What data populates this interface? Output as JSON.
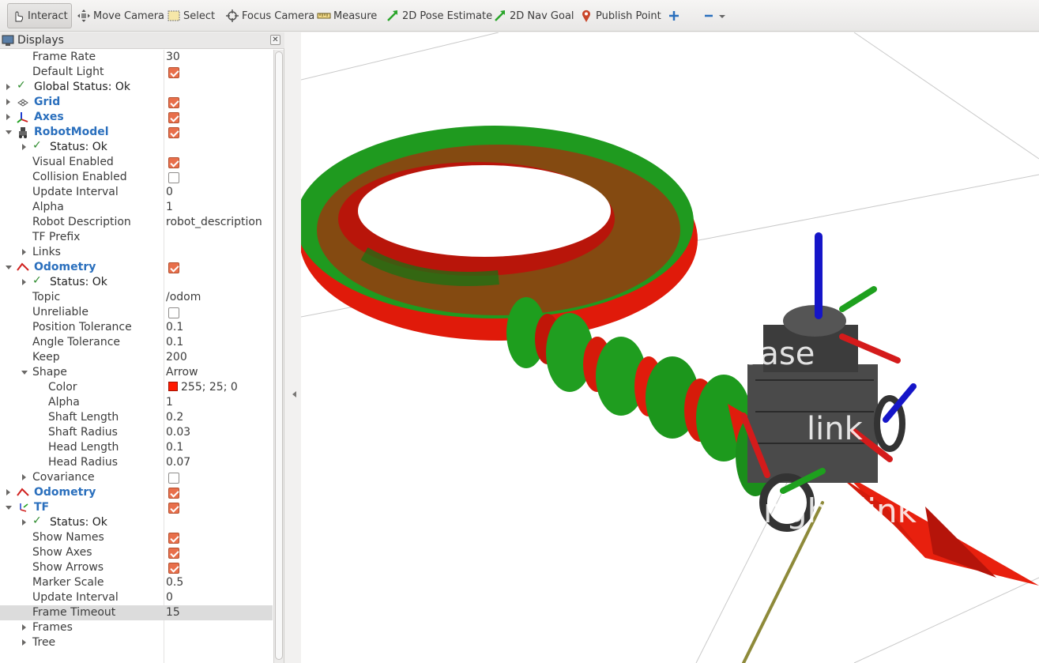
{
  "toolbar": {
    "tools": [
      {
        "label": "Interact",
        "icon": "hand-pointer-icon",
        "active": true
      },
      {
        "label": "Move Camera",
        "icon": "move-camera-icon"
      },
      {
        "label": "Select",
        "icon": "select-rectangle-icon"
      },
      {
        "label": "Focus Camera",
        "icon": "focus-crosshair-icon"
      },
      {
        "label": "Measure",
        "icon": "ruler-icon"
      },
      {
        "label": "2D Pose Estimate",
        "icon": "green-arrow-icon"
      },
      {
        "label": "2D Nav Goal",
        "icon": "green-arrow-icon"
      },
      {
        "label": "Publish Point",
        "icon": "map-pin-icon"
      }
    ],
    "add_tool_icon": "plus-icon",
    "remove_tool_icon": "minus-icon"
  },
  "displays": {
    "title": "Displays",
    "rows": [
      {
        "name": "Frame Rate",
        "value": "30"
      },
      {
        "name": "Default Light",
        "checkbox": true
      },
      {
        "name": "Global Status: Ok"
      },
      {
        "name": "Grid",
        "checkbox": true
      },
      {
        "name": "Axes",
        "checkbox": true
      },
      {
        "name": "RobotModel",
        "checkbox": true
      },
      {
        "name": "Status: Ok"
      },
      {
        "name": "Visual Enabled",
        "checkbox": true
      },
      {
        "name": "Collision Enabled",
        "checkbox": false
      },
      {
        "name": "Update Interval",
        "value": "0"
      },
      {
        "name": "Alpha",
        "value": "1"
      },
      {
        "name": "Robot Description",
        "value": "robot_description"
      },
      {
        "name": "TF Prefix",
        "value": ""
      },
      {
        "name": "Links"
      },
      {
        "name": "Odometry",
        "checkbox": true
      },
      {
        "name": "Status: Ok"
      },
      {
        "name": "Topic",
        "value": "/odom"
      },
      {
        "name": "Unreliable",
        "checkbox": false
      },
      {
        "name": "Position Tolerance",
        "value": "0.1"
      },
      {
        "name": "Angle Tolerance",
        "value": "0.1"
      },
      {
        "name": "Keep",
        "value": "200"
      },
      {
        "name": "Shape",
        "value": "Arrow"
      },
      {
        "name": "Color",
        "value": "255; 25; 0",
        "swatch": "#ff1900"
      },
      {
        "name": "Alpha",
        "value": "1"
      },
      {
        "name": "Shaft Length",
        "value": "0.2"
      },
      {
        "name": "Shaft Radius",
        "value": "0.03"
      },
      {
        "name": "Head Length",
        "value": "0.1"
      },
      {
        "name": "Head Radius",
        "value": "0.07"
      },
      {
        "name": "Covariance",
        "checkbox": false
      },
      {
        "name": "Odometry",
        "checkbox": true
      },
      {
        "name": "TF",
        "checkbox": true
      },
      {
        "name": "Status: Ok"
      },
      {
        "name": "Show Names",
        "checkbox": true
      },
      {
        "name": "Show Axes",
        "checkbox": true
      },
      {
        "name": "Show Arrows",
        "checkbox": true
      },
      {
        "name": "Marker Scale",
        "value": "0.5"
      },
      {
        "name": "Update Interval",
        "value": "0"
      },
      {
        "name": "Frame Timeout",
        "value": "15"
      },
      {
        "name": "Frames"
      },
      {
        "name": "Tree"
      }
    ]
  },
  "viewport": {
    "frame_labels": [
      "base",
      "link",
      "right_link"
    ]
  },
  "colors": {
    "accent_blue": "#2a6fbd",
    "checkbox_orange": "#e86f4b",
    "odom_red": "#ff1900",
    "odom_green": "#1ea01e"
  }
}
